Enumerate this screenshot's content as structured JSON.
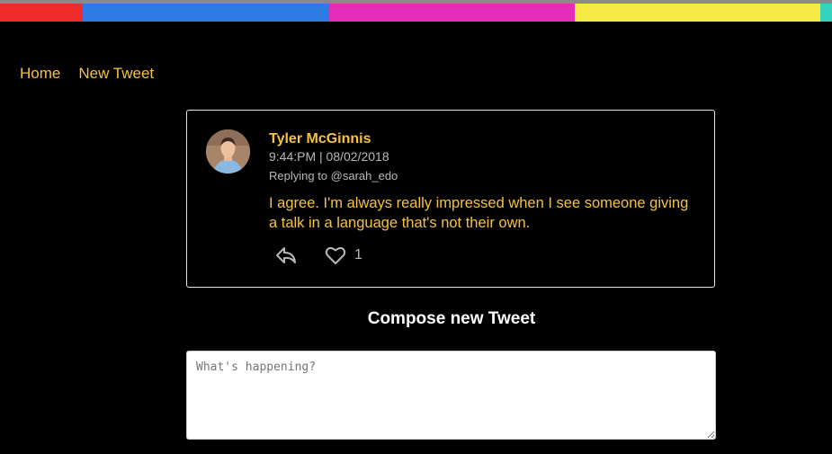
{
  "colors": {
    "accent": "#f5c242",
    "stripes": [
      "#ee2c2c",
      "#2e7be6",
      "#e52cb8",
      "#f5e944",
      "#33d3c0"
    ]
  },
  "nav": {
    "home": "Home",
    "new_tweet": "New Tweet"
  },
  "tweet": {
    "author": "Tyler McGinnis",
    "timestamp": "9:44:PM | 08/02/2018",
    "replying_to": "Replying to @sarah_edo",
    "text": "I agree. I'm always really impressed when I see someone giving a talk in a language that's not their own.",
    "like_count": "1",
    "reply_icon": "reply-icon",
    "like_icon": "heart-outline-icon"
  },
  "compose": {
    "title": "Compose new Tweet",
    "placeholder": "What's happening?"
  }
}
